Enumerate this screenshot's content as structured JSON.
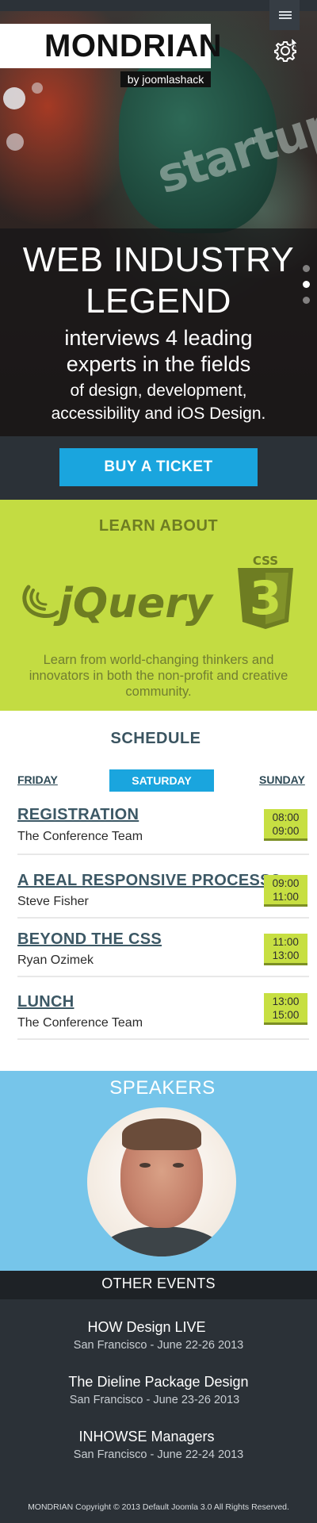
{
  "header": {
    "brand_title": "MONDRIAN",
    "brand_subtitle": "by joomlashack",
    "menu_icon": "hamburger-menu-icon",
    "settings_icon": "gear-icon"
  },
  "hero": {
    "headline": "WEB INDUSTRY LEGEND",
    "subheadline": "interviews 4 leading experts in the fields",
    "detail": "of design, development, accessibility and iOS Design.",
    "slides": 3,
    "active_slide": 2
  },
  "ticket": {
    "label": "BUY A TICKET"
  },
  "learn": {
    "title": "LEARN ABOUT",
    "logos": [
      "jquery-logo",
      "css3-logo"
    ],
    "jquery_text": "jQuery",
    "css_badge": "CSS",
    "css_number": "3",
    "description": "Learn from world-changing thinkers and innovators in both the non-profit and creative community."
  },
  "schedule": {
    "title": "SCHEDULE",
    "days": [
      "FRIDAY",
      "SATURDAY",
      "SUNDAY"
    ],
    "active_day": "SATURDAY",
    "items": [
      {
        "title": "REGISTRATION",
        "speaker": "The Conference Team",
        "start": "08:00",
        "end": "09:00"
      },
      {
        "title": "A REAL RESPONSIVE PROCESS?",
        "speaker": "Steve Fisher",
        "start": "09:00",
        "end": "11:00"
      },
      {
        "title": "BEYOND THE CSS",
        "speaker": "Ryan Ozimek",
        "start": "11:00",
        "end": "13:00"
      },
      {
        "title": "LUNCH",
        "speaker": "The Conference Team",
        "start": "13:00",
        "end": "15:00"
      }
    ]
  },
  "speakers": {
    "title": "SPEAKERS"
  },
  "other_events": {
    "title": "OTHER EVENTS",
    "events": [
      {
        "name": "HOW Design LIVE",
        "date": "San Francisco - June 22-26 2013"
      },
      {
        "name": "The Dieline Package Design",
        "date": "San Francisco - June 23-26 2013"
      },
      {
        "name": "INHOWSE Managers",
        "date": "San Francisco - June 22-24 2013"
      }
    ]
  },
  "footer": {
    "text": "MONDRIAN Copyright © 2013 Default Joomla 3.0 All Rights Reserved."
  },
  "colors": {
    "dark": "#2b3137",
    "accent_blue": "#1aa5de",
    "lime": "#c3dc42",
    "sky": "#76c5ea"
  }
}
